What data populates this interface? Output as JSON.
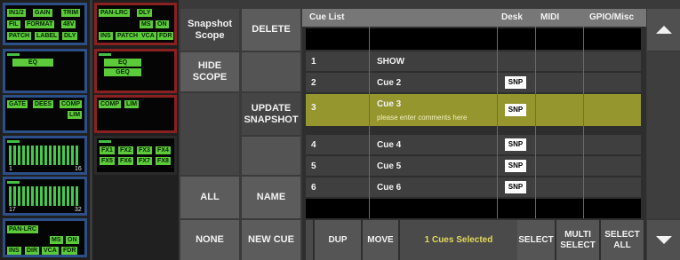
{
  "blue_strip": {
    "panel1": {
      "labels": [
        "IN1/2",
        "GAIN",
        "TRIM",
        "FIL",
        "FORMAT",
        "48V",
        "PATCH",
        "LABEL",
        "DLY"
      ]
    },
    "panel2": {
      "labels": [
        "EQ"
      ]
    },
    "panel3": {
      "labels": [
        "GATE",
        "DEES",
        "COMP",
        "LIM"
      ]
    },
    "meter1": {
      "start": "1",
      "end": "16"
    },
    "meter2": {
      "start": "17",
      "end": "32"
    },
    "panel6": {
      "labels": [
        "PAN-LRC",
        "MS",
        "ON",
        "INS",
        "DIR",
        "VCA",
        "FDR"
      ]
    }
  },
  "red_strip": {
    "panel1": {
      "labels": [
        "PAN-LRC",
        "DLY",
        "MS",
        "ON",
        "INS",
        "PATCH",
        "VCA",
        "FDR"
      ]
    },
    "panel2": {
      "labels": [
        "EQ",
        "GEQ"
      ]
    },
    "panel3": {
      "labels": [
        "COMP",
        "LIM"
      ]
    },
    "panel4": {
      "labels": [
        "FX1",
        "FX2",
        "FX3",
        "FX4",
        "FX5",
        "FX6",
        "FX7",
        "FX8"
      ]
    }
  },
  "scope_column": {
    "title": "Snapshot Scope",
    "hide_scope": "HIDE SCOPE",
    "all": "ALL",
    "none": "NONE"
  },
  "action_column": {
    "delete": "DELETE",
    "update_snapshot": "UPDATE SNAPSHOT",
    "name": "NAME",
    "new_cue": "NEW CUE"
  },
  "cue_list": {
    "tabs": {
      "cue_list": "Cue List",
      "desk": "Desk",
      "midi": "MIDI",
      "gpio": "GPIO/Misc"
    },
    "rows": [
      {
        "num": "1",
        "name": "SHOW",
        "snp": ""
      },
      {
        "num": "2",
        "name": "Cue 2",
        "snp": "SNP"
      },
      {
        "num": "3",
        "name": "Cue 3",
        "comment": "please enter comments here",
        "snp": "SNP"
      },
      {
        "num": "4",
        "name": "Cue 4",
        "snp": "SNP"
      },
      {
        "num": "5",
        "name": "Cue 5",
        "snp": "SNP"
      },
      {
        "num": "6",
        "name": "Cue 6",
        "snp": "SNP"
      }
    ],
    "selected_index": 2
  },
  "bottom_bar": {
    "dup": "DUP",
    "move": "MOVE",
    "status": "1 Cues Selected",
    "select": "SELECT",
    "multi_select": "MULTI SELECT",
    "select_all": "SELECT ALL"
  },
  "scroll": {
    "up_icon": "triangle-up-icon",
    "down_icon": "triangle-down-icon"
  },
  "colors": {
    "selected_row": "#96962e",
    "status_text": "#e4d85a",
    "label_green": "#5ccb3a",
    "strip_blue": "#2c4f88",
    "strip_red": "#8a2020"
  }
}
